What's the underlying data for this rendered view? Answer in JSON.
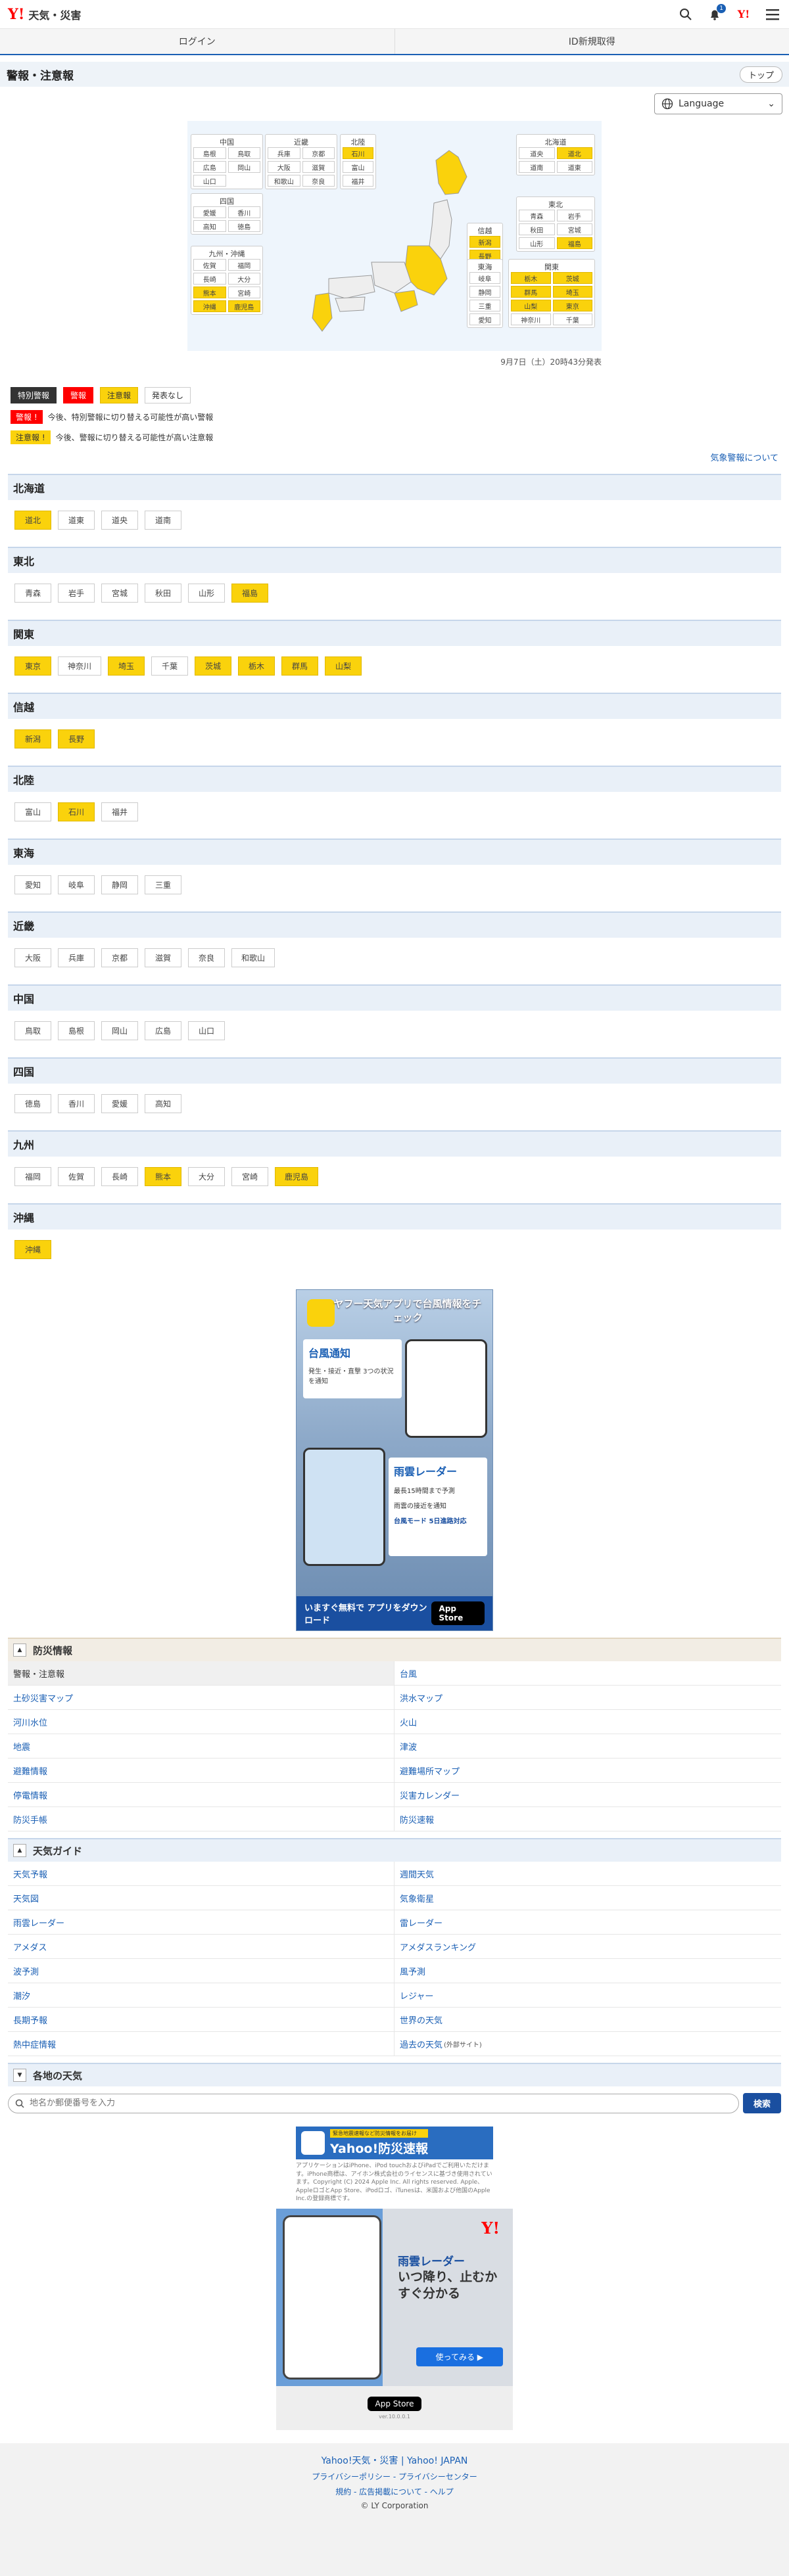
{
  "header": {
    "logo_y": "Y!",
    "logo_text": "天気・災害",
    "bell_count": "1",
    "yj": "Y!"
  },
  "loginbar": {
    "login": "ログイン",
    "signup": "ID新規取得"
  },
  "page": {
    "title": "警報・注意報",
    "top": "トップ",
    "language": "Language"
  },
  "map": {
    "regions": [
      {
        "name": "中国",
        "prefs": [
          [
            "島根",
            false
          ],
          [
            "鳥取",
            false
          ],
          [
            "広島",
            false
          ],
          [
            "岡山",
            false
          ],
          [
            "山口",
            false
          ]
        ]
      },
      {
        "name": "近畿",
        "prefs": [
          [
            "兵庫",
            false
          ],
          [
            "京都",
            false
          ],
          [
            "大阪",
            false
          ],
          [
            "滋賀",
            false
          ],
          [
            "和歌山",
            false
          ],
          [
            "奈良",
            false
          ]
        ]
      },
      {
        "name": "北陸",
        "prefs": [
          [
            "石川",
            true
          ],
          [
            "富山",
            false
          ],
          [
            "福井",
            false
          ]
        ]
      },
      {
        "name": "北海道",
        "prefs": [
          [
            "道央",
            false
          ],
          [
            "道北",
            true
          ],
          [
            "道南",
            false
          ],
          [
            "道東",
            false
          ]
        ]
      },
      {
        "name": "四国",
        "prefs": [
          [
            "愛媛",
            false
          ],
          [
            "香川",
            false
          ],
          [
            "高知",
            false
          ],
          [
            "徳島",
            false
          ]
        ]
      },
      {
        "name": "東北",
        "prefs": [
          [
            "青森",
            false
          ],
          [
            "岩手",
            false
          ],
          [
            "秋田",
            false
          ],
          [
            "宮城",
            false
          ],
          [
            "山形",
            false
          ],
          [
            "福島",
            true
          ]
        ]
      },
      {
        "name": "信越",
        "prefs": [
          [
            "新潟",
            true
          ],
          [
            "長野",
            true
          ]
        ]
      },
      {
        "name": "九州・沖縄",
        "prefs": [
          [
            "佐賀",
            false
          ],
          [
            "福岡",
            false
          ],
          [
            "長崎",
            false
          ],
          [
            "大分",
            false
          ],
          [
            "熊本",
            true
          ],
          [
            "宮崎",
            false
          ],
          [
            "沖縄",
            true
          ],
          [
            "鹿児島",
            true
          ]
        ]
      },
      {
        "name": "東海",
        "prefs": [
          [
            "岐阜",
            false
          ],
          [
            "静岡",
            false
          ],
          [
            "三重",
            false
          ],
          [
            "愛知",
            false
          ]
        ]
      },
      {
        "name": "関東",
        "prefs": [
          [
            "栃木",
            true
          ],
          [
            "茨城",
            true
          ],
          [
            "群馬",
            true
          ],
          [
            "埼玉",
            true
          ],
          [
            "山梨",
            true
          ],
          [
            "東京",
            true
          ],
          [
            "神奈川",
            false
          ],
          [
            "千葉",
            false
          ]
        ]
      }
    ],
    "timestamp": "9月7日（土）20時43分発表"
  },
  "legend": {
    "special": "特別警報",
    "warning": "警報",
    "advisory": "注意報",
    "none": "発表なし",
    "note_warn_tag": "警報 !",
    "note_warn_text": "今後、特別警報に切り替える可能性が高い警報",
    "note_adv_tag": "注意報 !",
    "note_adv_text": "今後、警報に切り替える可能性が高い注意報",
    "about": "気象警報について"
  },
  "regions": [
    {
      "name": "北海道",
      "prefs": [
        [
          "道北",
          true
        ],
        [
          "道東",
          false
        ],
        [
          "道央",
          false
        ],
        [
          "道南",
          false
        ]
      ]
    },
    {
      "name": "東北",
      "prefs": [
        [
          "青森",
          false
        ],
        [
          "岩手",
          false
        ],
        [
          "宮城",
          false
        ],
        [
          "秋田",
          false
        ],
        [
          "山形",
          false
        ],
        [
          "福島",
          true
        ]
      ]
    },
    {
      "name": "関東",
      "prefs": [
        [
          "東京",
          true
        ],
        [
          "神奈川",
          false
        ],
        [
          "埼玉",
          true
        ],
        [
          "千葉",
          false
        ],
        [
          "茨城",
          true
        ],
        [
          "栃木",
          true
        ],
        [
          "群馬",
          true
        ],
        [
          "山梨",
          true
        ]
      ]
    },
    {
      "name": "信越",
      "prefs": [
        [
          "新潟",
          true
        ],
        [
          "長野",
          true
        ]
      ]
    },
    {
      "name": "北陸",
      "prefs": [
        [
          "富山",
          false
        ],
        [
          "石川",
          true
        ],
        [
          "福井",
          false
        ]
      ]
    },
    {
      "name": "東海",
      "prefs": [
        [
          "愛知",
          false
        ],
        [
          "岐阜",
          false
        ],
        [
          "静岡",
          false
        ],
        [
          "三重",
          false
        ]
      ]
    },
    {
      "name": "近畿",
      "prefs": [
        [
          "大阪",
          false
        ],
        [
          "兵庫",
          false
        ],
        [
          "京都",
          false
        ],
        [
          "滋賀",
          false
        ],
        [
          "奈良",
          false
        ],
        [
          "和歌山",
          false
        ]
      ]
    },
    {
      "name": "中国",
      "prefs": [
        [
          "鳥取",
          false
        ],
        [
          "島根",
          false
        ],
        [
          "岡山",
          false
        ],
        [
          "広島",
          false
        ],
        [
          "山口",
          false
        ]
      ]
    },
    {
      "name": "四国",
      "prefs": [
        [
          "徳島",
          false
        ],
        [
          "香川",
          false
        ],
        [
          "愛媛",
          false
        ],
        [
          "高知",
          false
        ]
      ]
    },
    {
      "name": "九州",
      "prefs": [
        [
          "福岡",
          false
        ],
        [
          "佐賀",
          false
        ],
        [
          "長崎",
          false
        ],
        [
          "熊本",
          true
        ],
        [
          "大分",
          false
        ],
        [
          "宮崎",
          false
        ],
        [
          "鹿児島",
          true
        ]
      ]
    },
    {
      "name": "沖縄",
      "prefs": [
        [
          "沖縄",
          true
        ]
      ]
    }
  ],
  "ad1": {
    "headline": "ヤフー天気アプリで台風情報をチェック",
    "typhoon": "台風通知",
    "typhoon_sub": "発生・接近・直撃 3つの状況を通知",
    "radar": "雨雲レーダー",
    "radar_1": "最長15時間まで予測",
    "radar_2": "雨雲の接近を通知",
    "radar_3": "台風モード 5日進路対応",
    "foot": "いますぐ無料で アプリをダウンロード",
    "store": "App Store"
  },
  "bousai": {
    "title": "防災情報",
    "links": [
      "警報・注意報",
      "台風",
      "土砂災害マップ",
      "洪水マップ",
      "河川水位",
      "火山",
      "地震",
      "津波",
      "避難情報",
      "避難場所マップ",
      "停電情報",
      "災害カレンダー",
      "防災手帳",
      "防災速報"
    ]
  },
  "guide": {
    "title": "天気ガイド",
    "links": [
      "天気予報",
      "週間天気",
      "天気図",
      "気象衛星",
      "雨雲レーダー",
      "雷レーダー",
      "アメダス",
      "アメダスランキング",
      "波予測",
      "風予測",
      "潮汐",
      "レジャー",
      "長期予報",
      "世界の天気",
      "熱中症情報",
      "過去の天気"
    ],
    "ext": "(外部サイト)"
  },
  "local": {
    "title": "各地の天気",
    "placeholder": "地名か郵便番号を入力",
    "search": "検索"
  },
  "banner": {
    "small": "緊急地震速報など防災情報をお届け",
    "title": "Yahoo!防災速報",
    "copy": "アプリケーションはiPhone、iPod touchおよびiPadでご利用いただけます。iPhone商標は、アイホン株式会社のライセンスに基づき使用されています。Copyright (C) 2024 Apple Inc. All rights reserved. Apple、AppleロゴとApp Store、iPodロゴ、iTunesは、米国および他国のApple Inc.の登録商標です。"
  },
  "ad2": {
    "title": "雨雲レーダー",
    "line1": "いつ降り、止むか",
    "line2": "すぐ分かる",
    "try": "使ってみる ▶",
    "store": "App Store",
    "ver": "ver.10.0.0.1"
  },
  "footer": {
    "site": "Yahoo!天気・災害 | Yahoo! JAPAN",
    "l2": "プライバシーポリシー - プライバシーセンター",
    "l3": "規約 - 広告掲載について - ヘルプ",
    "copyright": "© LY Corporation"
  }
}
